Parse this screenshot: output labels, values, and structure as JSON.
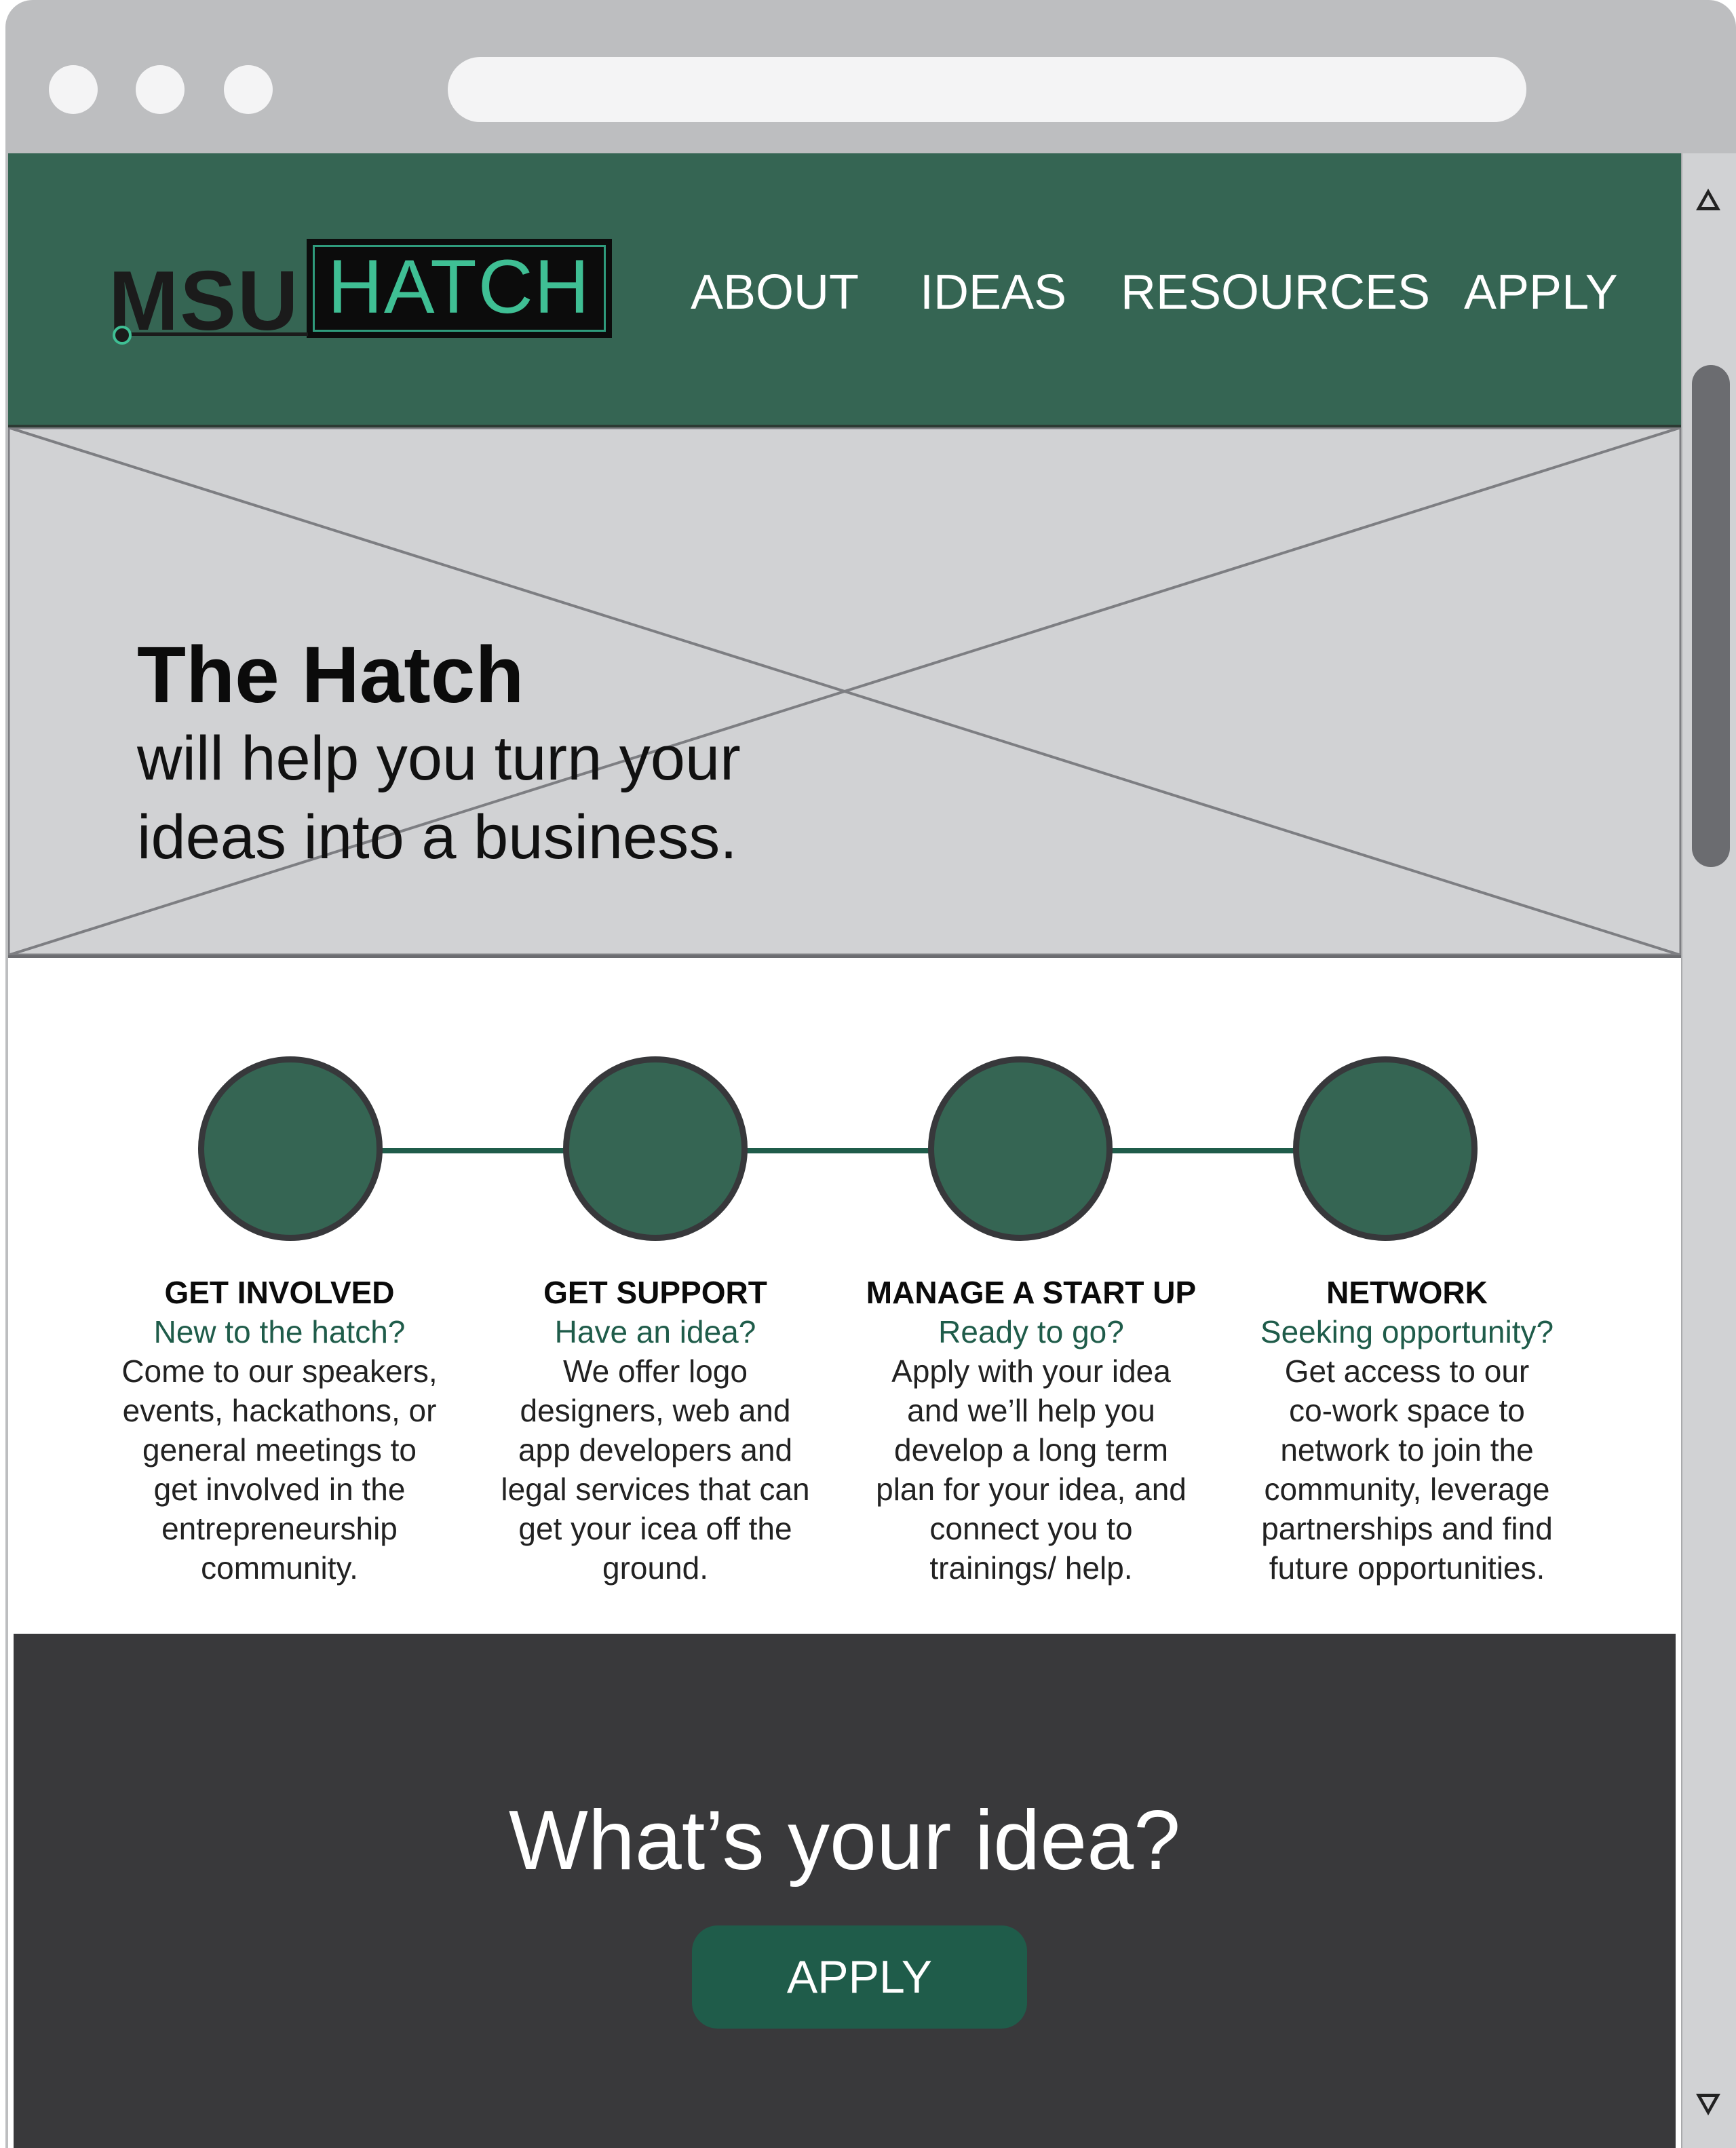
{
  "browser": {
    "window_buttons": [
      "close",
      "minimize",
      "maximize"
    ],
    "address_bar": ""
  },
  "header": {
    "logo": {
      "left_text": "MSU",
      "right_text": "HATCH"
    },
    "nav": [
      "ABOUT",
      "IDEAS",
      "RESOURCES",
      "APPLY"
    ]
  },
  "hero": {
    "title": "The Hatch",
    "subtitle_line1": "will help you turn your",
    "subtitle_line2": "ideas into a business."
  },
  "steps": [
    {
      "title": "GET INVOLVED",
      "subtitle": "New to the hatch?",
      "body": [
        "Come to our speakers,",
        "events, hackathons, or",
        "general meetings to",
        "get involved in the",
        "entrepreneurship",
        "community."
      ]
    },
    {
      "title": "GET SUPPORT",
      "subtitle": "Have an idea?",
      "body": [
        "We offer logo",
        "designers, web and",
        "app developers and",
        "legal services that can",
        "get your icea off the",
        "ground."
      ]
    },
    {
      "title": "MANAGE A START UP",
      "subtitle": "Ready to go?",
      "body": [
        "Apply with your idea",
        "and we’ll help you",
        "develop a long term",
        "plan for your idea, and",
        "connect you to",
        "trainings/ help."
      ]
    },
    {
      "title": "NETWORK",
      "subtitle": "Seeking opportunity?",
      "body": [
        "Get access to our",
        "co-work space to",
        "network to join the",
        "community, leverage",
        "partnerships and find",
        "future opportunities."
      ]
    }
  ],
  "cta": {
    "title": "What’s your idea?",
    "button": "APPLY"
  },
  "colors": {
    "brand_green": "#356553",
    "accent_green": "#1f5c4a",
    "logo_green": "#3fbf94",
    "dark_band": "#39393b",
    "placeholder_gray": "#d1d2d4"
  },
  "icons": [
    "scroll-up-arrow-icon",
    "scroll-down-arrow-icon",
    "logo-node-icon"
  ]
}
